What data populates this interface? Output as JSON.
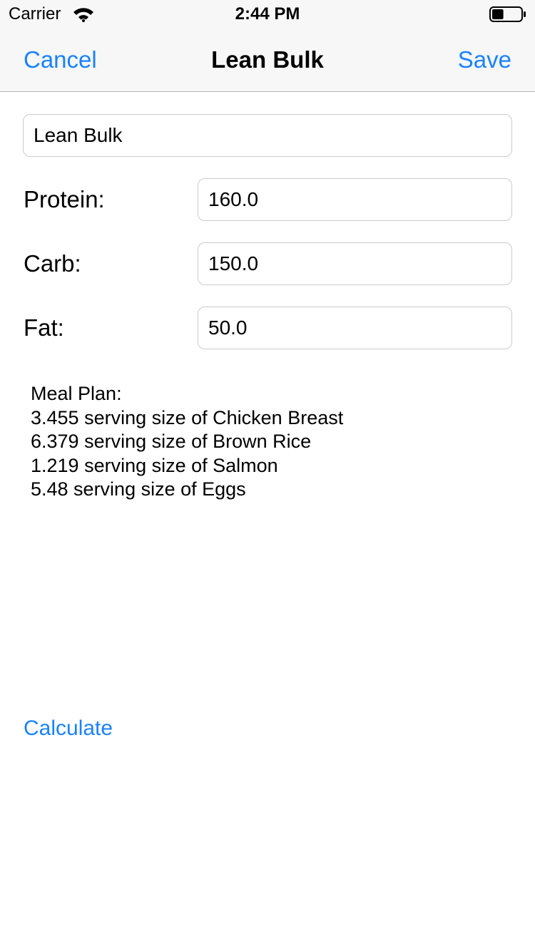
{
  "status_bar": {
    "carrier": "Carrier",
    "time": "2:44 PM",
    "battery_level": 0.4
  },
  "nav": {
    "cancel_label": "Cancel",
    "title": "Lean Bulk",
    "save_label": "Save",
    "accent_color": "#1a82ff"
  },
  "form": {
    "name_value": "Lean Bulk",
    "protein_label": "Protein:",
    "protein_value": "160.0",
    "carb_label": "Carb:",
    "carb_value": "150.0",
    "fat_label": "Fat:",
    "fat_value": "50.0"
  },
  "meal_plan": {
    "heading": "Meal Plan:",
    "items": [
      "3.455 serving size of Chicken Breast",
      "6.379 serving size of Brown Rice",
      "1.219 serving size of Salmon",
      "5.48 serving size of Eggs"
    ]
  },
  "calculate_label": "Calculate"
}
